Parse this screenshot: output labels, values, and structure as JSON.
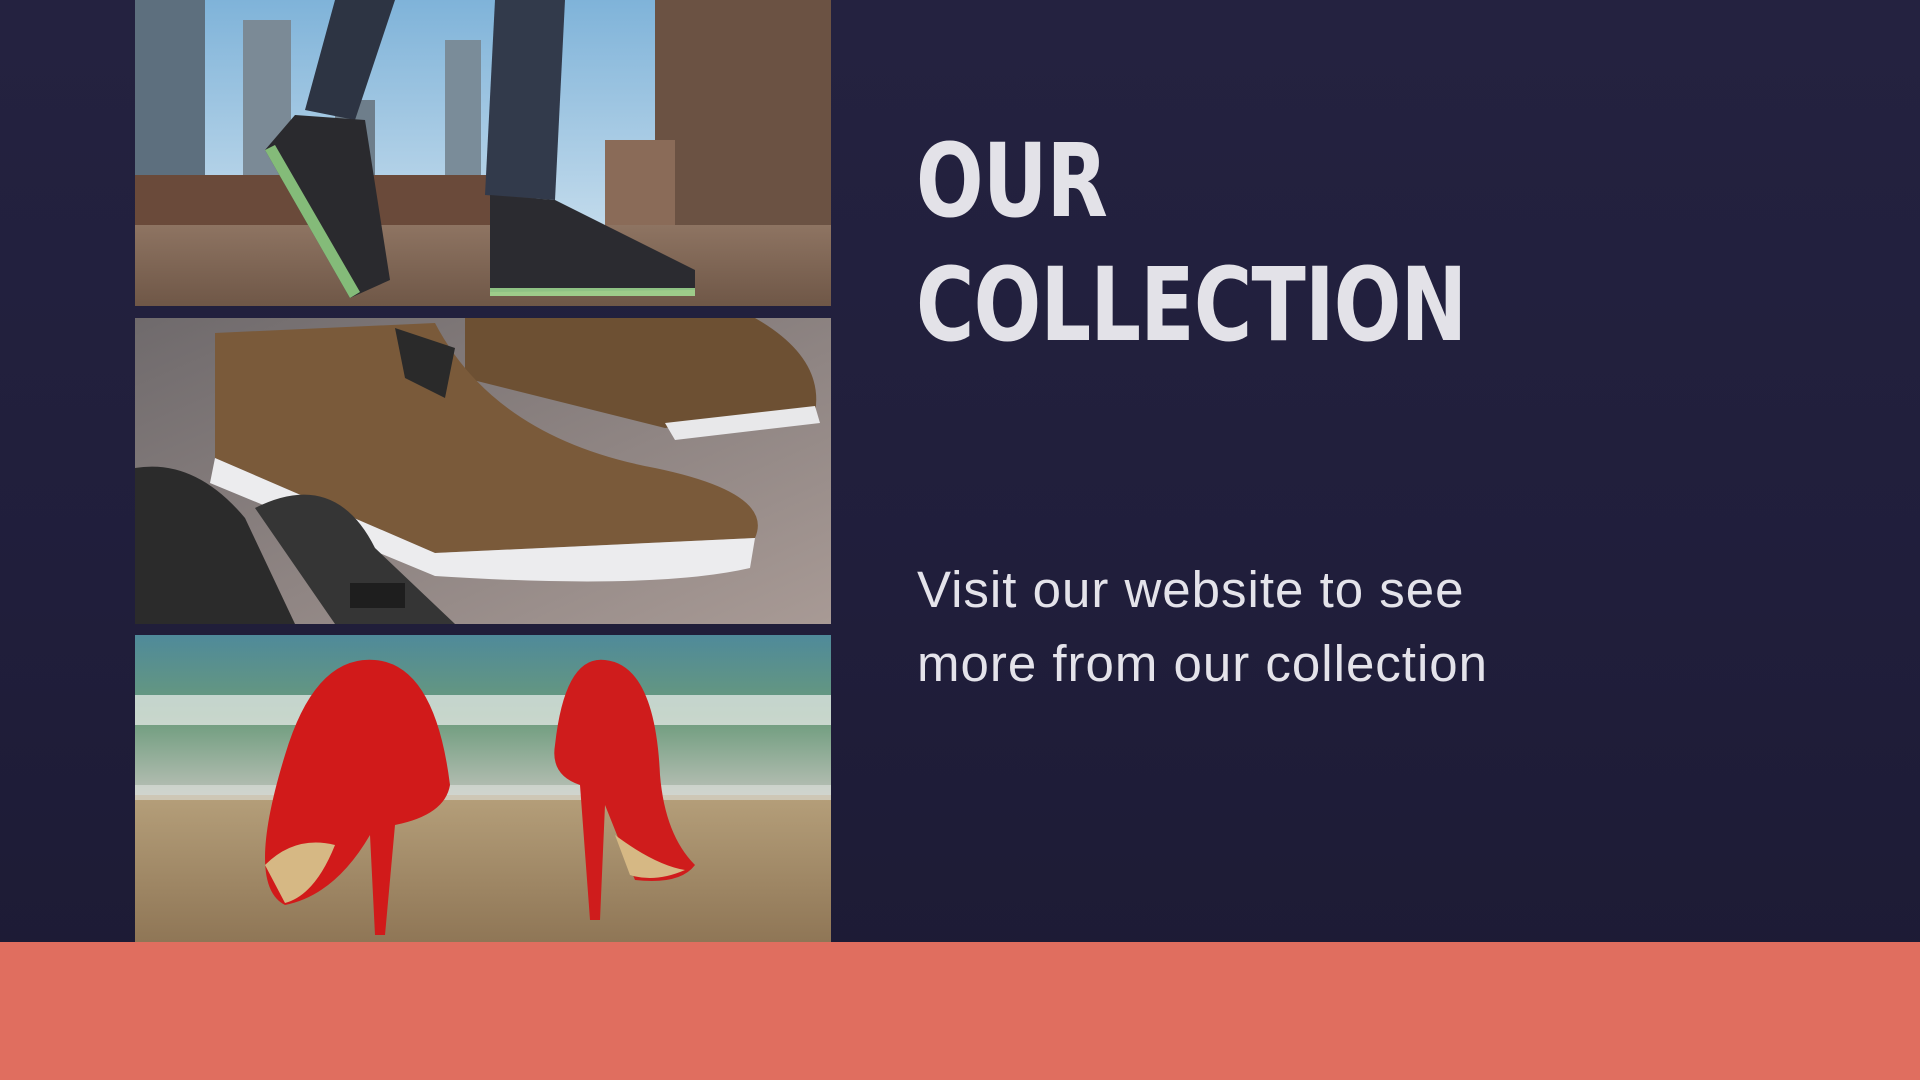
{
  "slide": {
    "title_lines": [
      "OUR",
      "COLLECTION"
    ],
    "subtitle_lines": [
      "Visit our website to see",
      "more from our collection"
    ]
  },
  "colors": {
    "background": "#221f3e",
    "accent_band": "#e06e5f",
    "text": "#e3e2e8"
  },
  "photos": [
    {
      "name": "sneakers-city-photo",
      "depicts": "light-up black sneakers walking on a rooftop with city skyline"
    },
    {
      "name": "suede-shoes-photo",
      "depicts": "brown suede sneakers on wooden floor next to a bag strap"
    },
    {
      "name": "red-heels-beach-photo",
      "depicts": "red high heels standing on a sandy beach by the sea"
    }
  ]
}
